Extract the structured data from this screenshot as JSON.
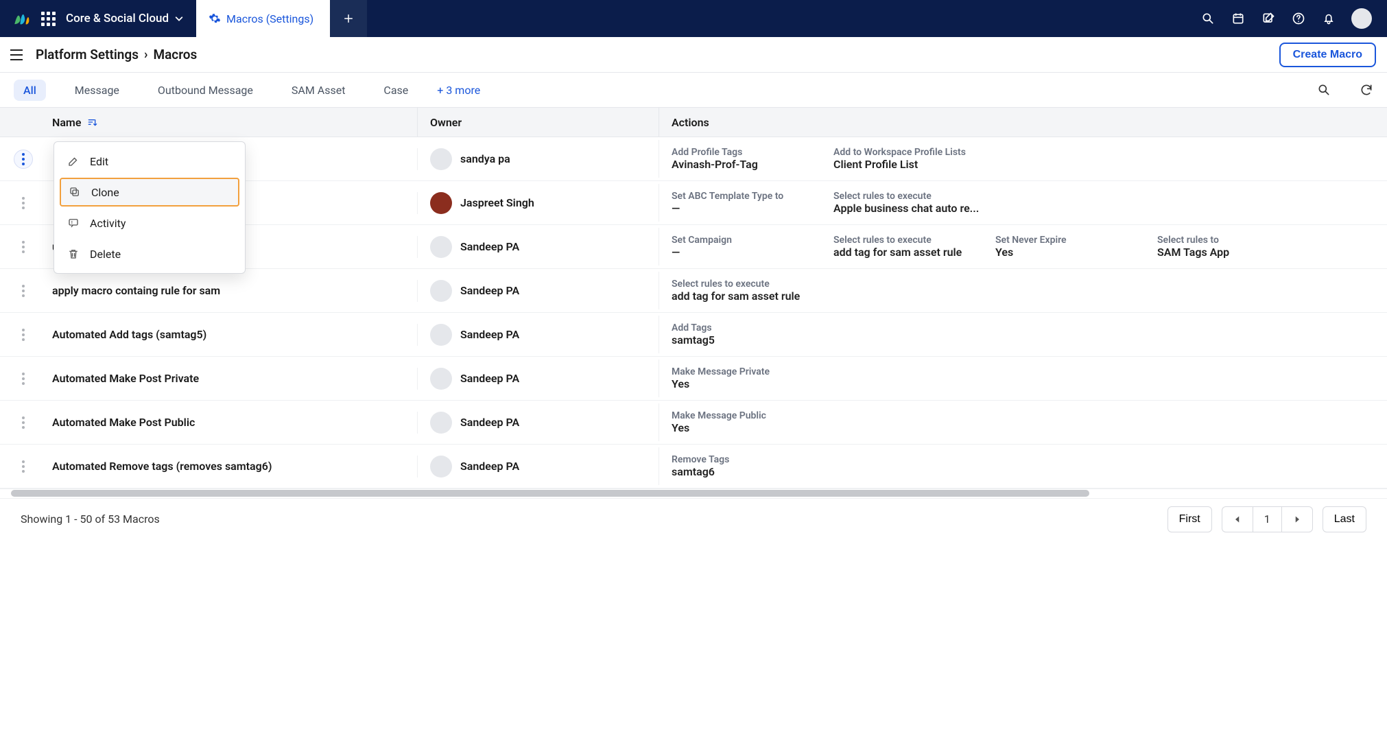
{
  "header": {
    "workspace": "Core & Social Cloud",
    "active_tab": "Macros (Settings)"
  },
  "breadcrumb": {
    "root": "Platform Settings",
    "current": "Macros"
  },
  "buttons": {
    "create": "Create Macro"
  },
  "filters": [
    "All",
    "Message",
    "Outbound Message",
    "SAM Asset",
    "Case"
  ],
  "filters_more": "+ 3 more",
  "columns": {
    "name": "Name",
    "owner": "Owner",
    "actions": "Actions"
  },
  "context_menu": [
    "Edit",
    "Clone",
    "Activity",
    "Delete"
  ],
  "rows": [
    {
      "name": "",
      "owner": "sandya pa",
      "avatarColor": "#e5e7eb",
      "actions": [
        {
          "label": "Add Profile Tags",
          "value": "Avinash-Prof-Tag"
        },
        {
          "label": "Add to Workspace Profile Lists",
          "value": "Client Profile List"
        }
      ]
    },
    {
      "name": "",
      "owner": "Jaspreet Singh",
      "avatarColor": "#8b2d1e",
      "actions": [
        {
          "label": "Set ABC Template Type to",
          "value": "—"
        },
        {
          "label": "Select rules to execute",
          "value": "Apple business chat auto re..."
        }
      ]
    },
    {
      "name": "ule & set nvr expire",
      "owner": "Sandeep PA",
      "avatarColor": "#e5e7eb",
      "actions": [
        {
          "label": "Set Campaign",
          "value": "—"
        },
        {
          "label": "Select rules to execute",
          "value": "add tag for sam asset rule"
        },
        {
          "label": "Set Never Expire",
          "value": "Yes"
        },
        {
          "label": "Select rules to",
          "value": "SAM Tags App"
        }
      ]
    },
    {
      "name": "apply macro containg rule for sam",
      "owner": "Sandeep PA",
      "avatarColor": "#e5e7eb",
      "actions": [
        {
          "label": "Select rules to execute",
          "value": "add tag for sam asset rule"
        }
      ]
    },
    {
      "name": "Automated Add tags (samtag5)",
      "owner": "Sandeep PA",
      "avatarColor": "#e5e7eb",
      "actions": [
        {
          "label": "Add Tags",
          "value": "samtag5"
        }
      ]
    },
    {
      "name": "Automated Make Post Private",
      "owner": "Sandeep PA",
      "avatarColor": "#e5e7eb",
      "actions": [
        {
          "label": "Make Message Private",
          "value": "Yes"
        }
      ]
    },
    {
      "name": "Automated Make Post Public",
      "owner": "Sandeep PA",
      "avatarColor": "#e5e7eb",
      "actions": [
        {
          "label": "Make Message Public",
          "value": "Yes"
        }
      ]
    },
    {
      "name": "Automated Remove tags (removes samtag6)",
      "owner": "Sandeep PA",
      "avatarColor": "#e5e7eb",
      "actions": [
        {
          "label": "Remove Tags",
          "value": "samtag6"
        }
      ]
    }
  ],
  "footer": {
    "summary": "Showing 1 - 50 of 53 Macros",
    "first": "First",
    "last": "Last",
    "page": "1"
  }
}
